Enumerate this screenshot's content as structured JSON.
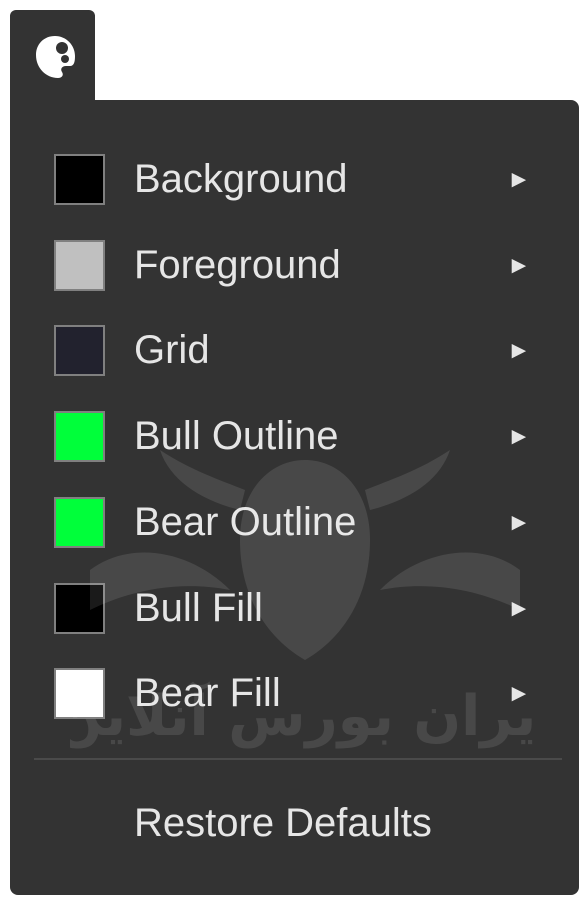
{
  "menu": {
    "items": [
      {
        "label": "Background",
        "swatch_color": "#000000",
        "arrow": "►"
      },
      {
        "label": "Foreground",
        "swatch_color": "#c0c0c0",
        "arrow": "►"
      },
      {
        "label": "Grid",
        "swatch_color": "#22222e",
        "arrow": "►"
      },
      {
        "label": "Bull Outline",
        "swatch_color": "#00ff3a",
        "arrow": "►"
      },
      {
        "label": "Bear Outline",
        "swatch_color": "#00ff3a",
        "arrow": "►"
      },
      {
        "label": "Bull Fill",
        "swatch_color": "#000000",
        "arrow": "►"
      },
      {
        "label": "Bear Fill",
        "swatch_color": "#ffffff",
        "arrow": "►"
      }
    ],
    "restore_label": "Restore Defaults"
  },
  "tab": {
    "icon": "palette-icon"
  },
  "watermark": {
    "text": "ایران بورس آنلاین"
  },
  "colors": {
    "panel": "#333333",
    "text": "#e6e6e6",
    "swatch_border": "#808080"
  }
}
